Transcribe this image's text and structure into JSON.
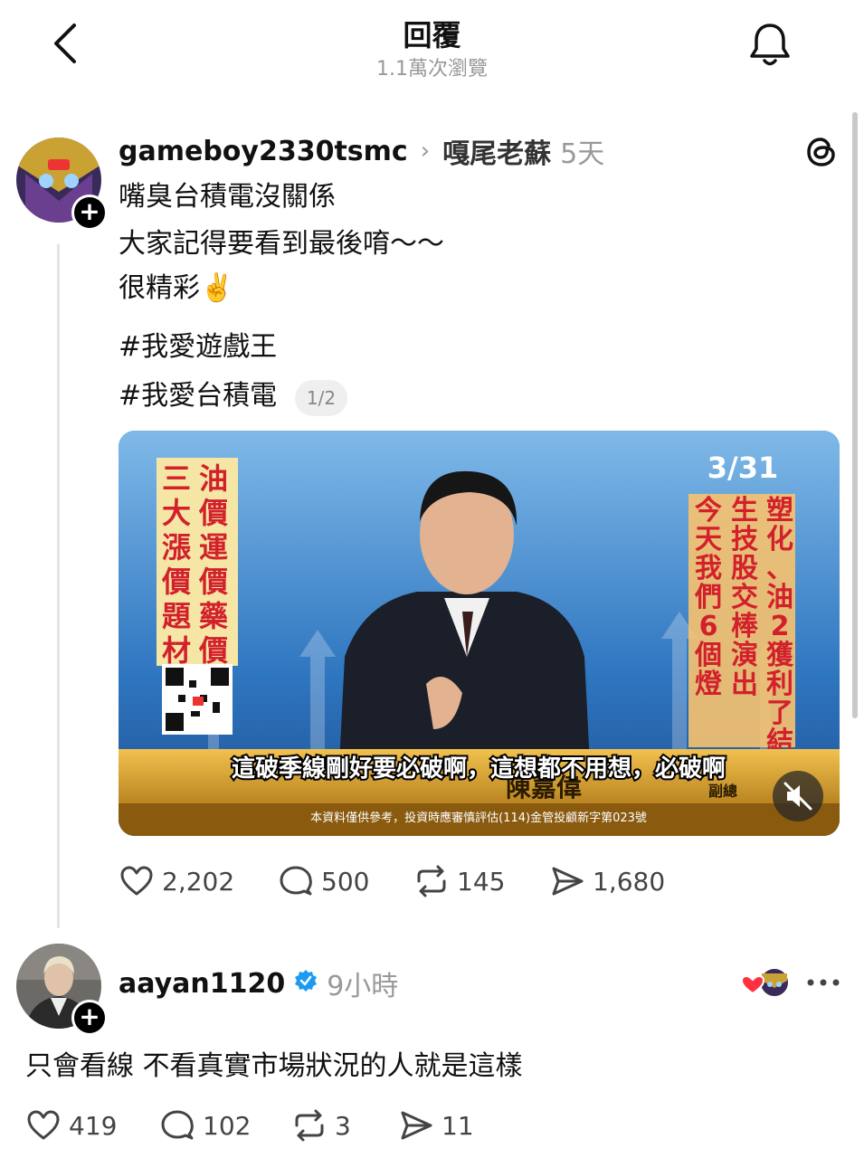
{
  "header": {
    "title": "回覆",
    "views": "1.1萬次瀏覽"
  },
  "post1": {
    "username": "gameboy2330tsmc",
    "replied_to": "嘎尾老蘇",
    "time": "5天",
    "lines": [
      "嘴臭台積電沒關係",
      "大家記得要看到最後唷～～",
      "很精彩✌️"
    ],
    "hashtags": [
      "#我愛遊戲王",
      "#我愛台積電"
    ],
    "page_indicator": "1/2",
    "video": {
      "date": "3/31",
      "left_col1": "油價運價藥價",
      "left_col2": "三大漲價題材",
      "right_col1": "塑化、油2獲利了結",
      "right_col2": "生技股交棒演出",
      "right_col3": "今天我們6個燈",
      "subtitle": "這破季線剛好要必破啊，這想都不用想，必破啊",
      "name_plate": "陳嘉偉",
      "role": "副總",
      "disclaimer": "本資料僅供參考，投資時應審慎評估(114)金管投顧新字第023號"
    },
    "stats": {
      "likes": "2,202",
      "comments": "500",
      "reposts": "145",
      "shares": "1,680"
    }
  },
  "post2": {
    "username": "aayan1120",
    "time": "9小時",
    "text": "只會看線 不看真實市場狀況的人就是這樣",
    "stats": {
      "likes": "419",
      "comments": "102",
      "reposts": "3",
      "shares": "11"
    }
  },
  "colors": {
    "accent_blue": "#1d9bf0",
    "like_red": "#ff3040",
    "muted": "#999999"
  }
}
